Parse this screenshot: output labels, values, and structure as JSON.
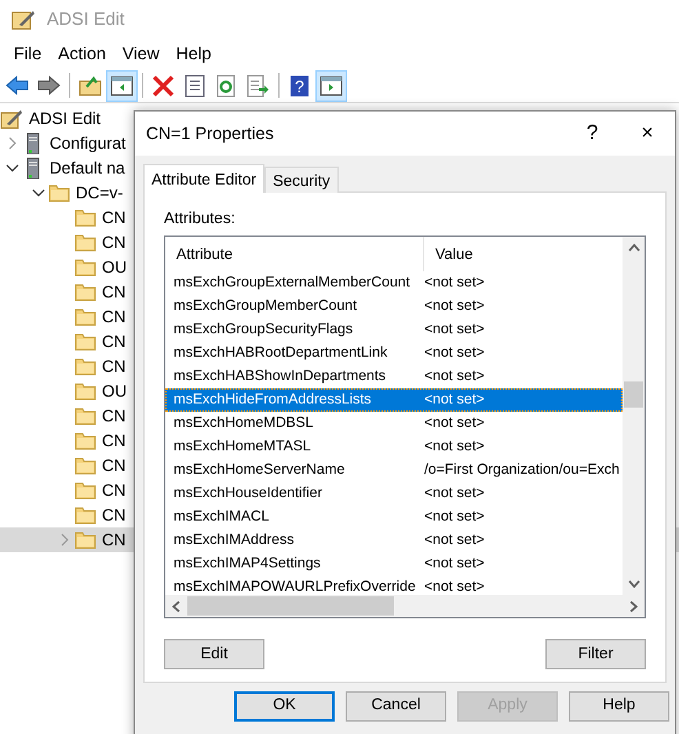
{
  "window": {
    "title": "ADSI Edit"
  },
  "menu": [
    "File",
    "Action",
    "View",
    "Help"
  ],
  "toolbar": [
    {
      "kind": "back",
      "pressed": false
    },
    {
      "kind": "forward",
      "pressed": false
    },
    {
      "kind": "sep"
    },
    {
      "kind": "up-folder",
      "pressed": false
    },
    {
      "kind": "console-tree",
      "pressed": true
    },
    {
      "kind": "sep"
    },
    {
      "kind": "delete",
      "pressed": false
    },
    {
      "kind": "properties",
      "pressed": false
    },
    {
      "kind": "refresh",
      "pressed": false
    },
    {
      "kind": "export",
      "pressed": false
    },
    {
      "kind": "sep"
    },
    {
      "kind": "help",
      "label": "?",
      "pressed": false
    },
    {
      "kind": "action-pane",
      "pressed": true
    }
  ],
  "tree": [
    {
      "label": "ADSI Edit",
      "kind": "root",
      "selected": false,
      "children": [
        {
          "label": "Configurat",
          "kind": "server",
          "expandable": true,
          "expanded": false,
          "selected": false
        },
        {
          "label": "Default na",
          "kind": "server",
          "expandable": true,
          "expanded": true,
          "selected": false,
          "children": [
            {
              "label": "DC=v-",
              "kind": "folder",
              "expandable": true,
              "expanded": true,
              "selected": false,
              "children": [
                {
                  "label": "CN",
                  "kind": "folder",
                  "expandable": false,
                  "selected": false
                },
                {
                  "label": "CN",
                  "kind": "folder",
                  "expandable": false,
                  "selected": false
                },
                {
                  "label": "OU",
                  "kind": "folder",
                  "expandable": false,
                  "selected": false
                },
                {
                  "label": "CN",
                  "kind": "folder",
                  "expandable": false,
                  "selected": false
                },
                {
                  "label": "CN",
                  "kind": "folder",
                  "expandable": false,
                  "selected": false
                },
                {
                  "label": "CN",
                  "kind": "folder",
                  "expandable": false,
                  "selected": false
                },
                {
                  "label": "CN",
                  "kind": "folder",
                  "expandable": false,
                  "selected": false
                },
                {
                  "label": "OU",
                  "kind": "folder",
                  "expandable": false,
                  "selected": false
                },
                {
                  "label": "CN",
                  "kind": "folder",
                  "expandable": false,
                  "selected": false
                },
                {
                  "label": "CN",
                  "kind": "folder",
                  "expandable": false,
                  "selected": false
                },
                {
                  "label": "CN",
                  "kind": "folder",
                  "expandable": false,
                  "selected": false
                },
                {
                  "label": "CN",
                  "kind": "folder",
                  "expandable": false,
                  "selected": false
                },
                {
                  "label": "CN",
                  "kind": "folder",
                  "expandable": false,
                  "selected": false
                },
                {
                  "label": "CN",
                  "kind": "folder",
                  "expandable": true,
                  "expanded": false,
                  "selected": true
                }
              ]
            }
          ]
        }
      ]
    }
  ],
  "dialog": {
    "title": "CN=1 Properties",
    "help": "?",
    "close": "×",
    "tabs": [
      {
        "label": "Attribute Editor",
        "selected": true
      },
      {
        "label": "Security",
        "selected": false
      }
    ],
    "attributes_label": "Attributes:",
    "columns": [
      "Attribute",
      "Value"
    ],
    "rows": [
      {
        "attribute": "msExchGroupExternalMemberCount",
        "value": "<not set>",
        "selected": false
      },
      {
        "attribute": "msExchGroupMemberCount",
        "value": "<not set>",
        "selected": false
      },
      {
        "attribute": "msExchGroupSecurityFlags",
        "value": "<not set>",
        "selected": false
      },
      {
        "attribute": "msExchHABRootDepartmentLink",
        "value": "<not set>",
        "selected": false
      },
      {
        "attribute": "msExchHABShowInDepartments",
        "value": "<not set>",
        "selected": false
      },
      {
        "attribute": "msExchHideFromAddressLists",
        "value": "<not set>",
        "selected": true
      },
      {
        "attribute": "msExchHomeMDBSL",
        "value": "<not set>",
        "selected": false
      },
      {
        "attribute": "msExchHomeMTASL",
        "value": "<not set>",
        "selected": false
      },
      {
        "attribute": "msExchHomeServerName",
        "value": "/o=First Organization/ou=Exch",
        "selected": false
      },
      {
        "attribute": "msExchHouseIdentifier",
        "value": "<not set>",
        "selected": false
      },
      {
        "attribute": "msExchIMACL",
        "value": "<not set>",
        "selected": false
      },
      {
        "attribute": "msExchIMAddress",
        "value": "<not set>",
        "selected": false
      },
      {
        "attribute": "msExchIMAP4Settings",
        "value": "<not set>",
        "selected": false
      },
      {
        "attribute": "msExchIMAPOWAURLPrefixOverride",
        "value": "<not set>",
        "selected": false
      }
    ],
    "panel_buttons": [
      "Edit",
      "Filter"
    ],
    "buttons": [
      {
        "label": "OK",
        "default": true,
        "disabled": false
      },
      {
        "label": "Cancel",
        "default": false,
        "disabled": false
      },
      {
        "label": "Apply",
        "default": false,
        "disabled": true
      },
      {
        "label": "Help",
        "default": false,
        "disabled": false
      }
    ]
  }
}
